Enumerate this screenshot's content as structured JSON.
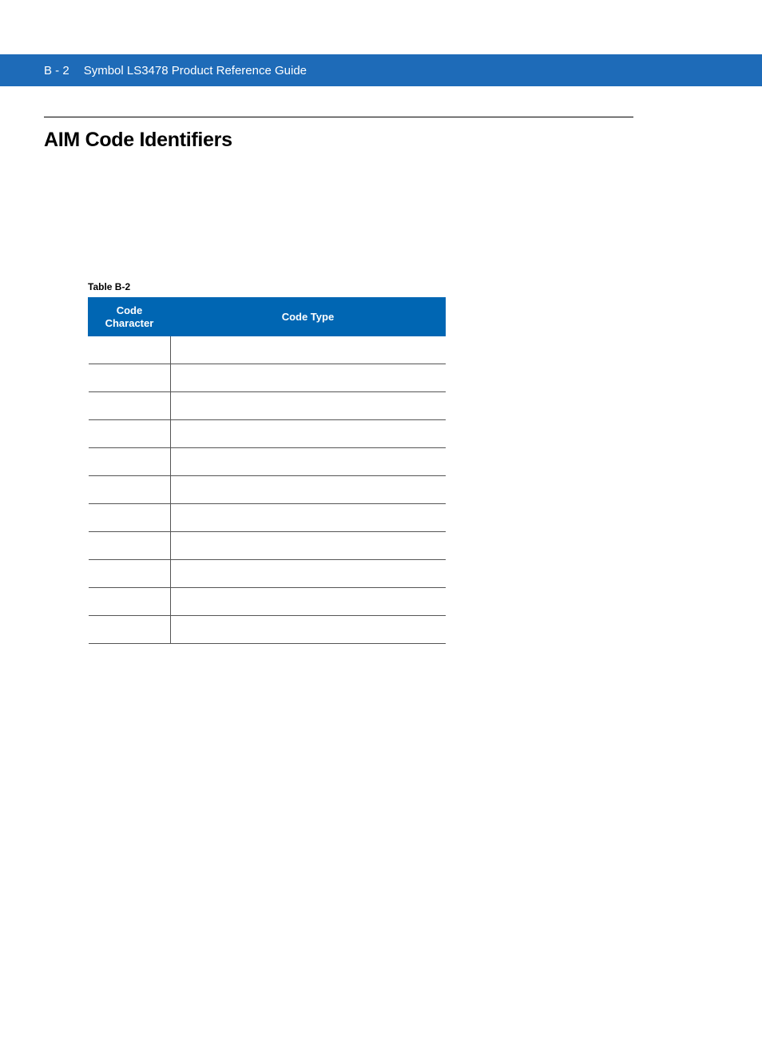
{
  "header": {
    "page_label": "B - 2",
    "doc_title": "Symbol LS3478 Product Reference Guide"
  },
  "section": {
    "title": "AIM Code Identifiers"
  },
  "table": {
    "caption": "Table B-2",
    "col1_header": "Code Character",
    "col2_header": "Code Type",
    "rows": [
      {
        "char": "",
        "type": ""
      },
      {
        "char": "",
        "type": ""
      },
      {
        "char": "",
        "type": ""
      },
      {
        "char": "",
        "type": ""
      },
      {
        "char": "",
        "type": ""
      },
      {
        "char": "",
        "type": ""
      },
      {
        "char": "",
        "type": ""
      },
      {
        "char": "",
        "type": ""
      },
      {
        "char": "",
        "type": ""
      },
      {
        "char": "",
        "type": ""
      },
      {
        "char": "",
        "type": ""
      }
    ]
  }
}
